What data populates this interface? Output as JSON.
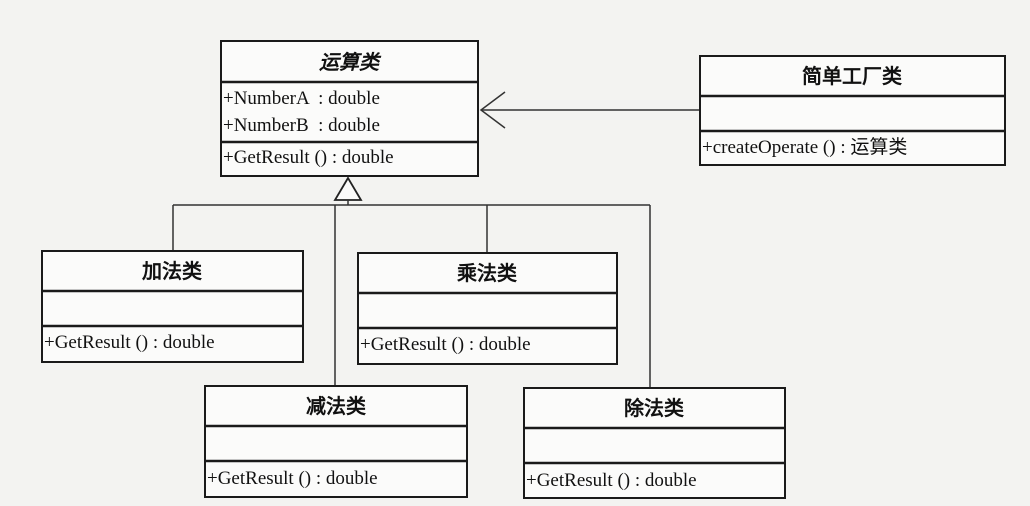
{
  "classes": {
    "operation": {
      "name": "运算类",
      "attributes": [
        "+NumberA  : double",
        "+NumberB  : double"
      ],
      "methods": [
        "+GetResult () : double"
      ]
    },
    "factory": {
      "name": "简单工厂类",
      "methods": [
        "+createOperate () : 运算类"
      ]
    },
    "add": {
      "name": "加法类",
      "methods": [
        "+GetResult () : double"
      ]
    },
    "mul": {
      "name": "乘法类",
      "methods": [
        "+GetResult () : double"
      ]
    },
    "sub": {
      "name": "减法类",
      "methods": [
        "+GetResult () : double"
      ]
    },
    "div": {
      "name": "除法类",
      "methods": [
        "+GetResult () : double"
      ]
    }
  },
  "relations": [
    {
      "type": "association",
      "from": "简单工厂类",
      "to": "运算类"
    },
    {
      "type": "generalization",
      "from": "加法类",
      "to": "运算类"
    },
    {
      "type": "generalization",
      "from": "减法类",
      "to": "运算类"
    },
    {
      "type": "generalization",
      "from": "乘法类",
      "to": "运算类"
    },
    {
      "type": "generalization",
      "from": "除法类",
      "to": "运算类"
    }
  ]
}
